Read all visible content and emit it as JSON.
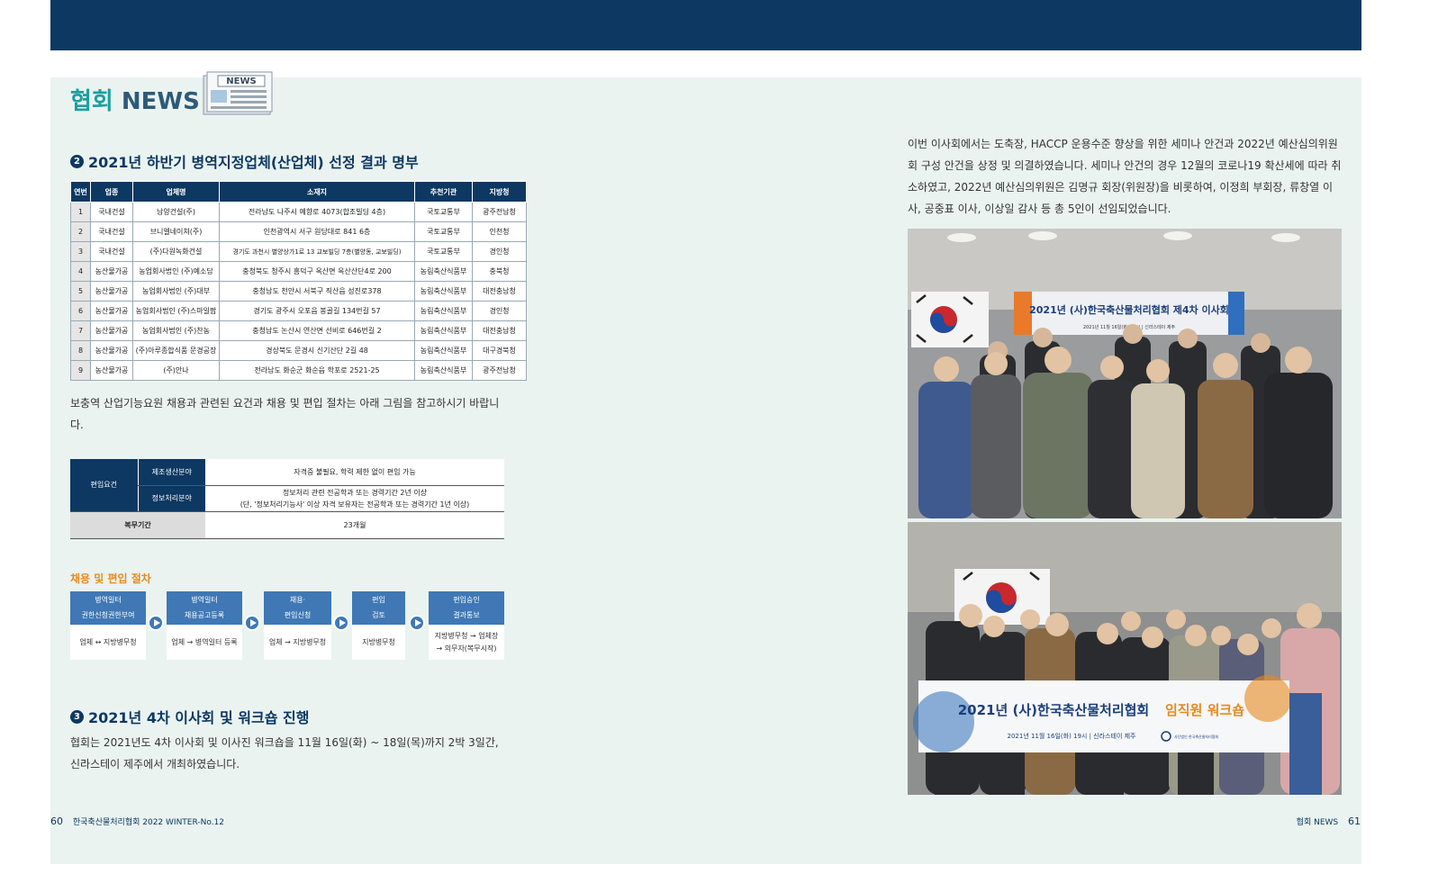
{
  "header": {
    "brand_ko": "협회",
    "brand_en": "NEWS",
    "badge": "NEWS"
  },
  "section2": {
    "num": "2",
    "title": "2021년 하반기 병역지정업체(산업체) 선정 결과 명부",
    "table": {
      "headers": [
        "연번",
        "업종",
        "업체명",
        "소재지",
        "추천기관",
        "지방청"
      ],
      "rows": [
        [
          "1",
          "국내건설",
          "남양건설(주)",
          "전라남도 나주시 예향로 4073(합조빌딩 4층)",
          "국토교통부",
          "광주전남청"
        ],
        [
          "2",
          "국내건설",
          "브니엘네이쳐(주)",
          "인천광역시 서구 원당대로 841 6층",
          "국토교통부",
          "인천청"
        ],
        [
          "3",
          "국내건설",
          "(주)다원녹화건설",
          "경기도 과천시 별양상가1로 13 교보빌딩 7층(별양동, 교보빌딩)",
          "국토교통부",
          "경인청"
        ],
        [
          "4",
          "농산물가공",
          "농업회사법인 (주)예소담",
          "충청북도 청주시 흥덕구 옥산면 옥산산단4로 200",
          "농림축산식품부",
          "충북청"
        ],
        [
          "5",
          "농산물가공",
          "농업회사법인 (주)대부",
          "충청남도 천안시 서북구 직산읍 성진로378",
          "농림축산식품부",
          "대전충남청"
        ],
        [
          "6",
          "농산물가공",
          "농업회사법인 (주)스마일팜",
          "경기도 광주시 오포읍 봉골길 134번길 57",
          "농림축산식품부",
          "경인청"
        ],
        [
          "7",
          "농산물가공",
          "농업회사법인 (주)찬농",
          "충청남도 논산시 연산면 선비로 646번길 2",
          "농림축산식품부",
          "대전충남청"
        ],
        [
          "8",
          "농산물가공",
          "(주)아루종합식품 문경공장",
          "경상북도 문경시 신기산단 2길 48",
          "농림축산식품부",
          "대구경북청"
        ],
        [
          "9",
          "농산물가공",
          "(주)안나",
          "전라남도 화순군 화순읍 학포로 2521-25",
          "농림축산식품부",
          "광주전남청"
        ]
      ]
    },
    "note": "보충역 산업기능요원 채용과 관련된 요건과 채용 및 편입 절차는 아래 그림을 참고하시기 바랍니다.",
    "requirements": {
      "group": "편입요건",
      "manufacturing_label": "제조생산분야",
      "manufacturing_value": "자격증 불필요, 학력 제한 없이 편입 가능",
      "it_label": "정보처리분야",
      "it_value_1": "정보처리 관련 전공학과 또는 경력기간 2년 이상",
      "it_value_2": "(단, '정보처리기능사' 이상 자격 보유자는 전공학과 또는 경력기간 1년 이상)",
      "service_label": "복무기간",
      "service_value": "23개월"
    },
    "process": {
      "title": "채용 및 편입 절차",
      "steps": [
        {
          "head1": "병역일터",
          "head2": "권한신청권한부여",
          "body1": "업체 ↔ 지방병무청",
          "body2": ""
        },
        {
          "head1": "병역일터",
          "head2": "채용공고등록",
          "body1": "업체 → 병역일터 등록",
          "body2": ""
        },
        {
          "head1": "채용·",
          "head2": "편입신청",
          "body1": "업체 → 지방병무청",
          "body2": ""
        },
        {
          "head1": "편입",
          "head2": "검토",
          "body1": "지방병무청",
          "body2": ""
        },
        {
          "head1": "편입승인",
          "head2": "결과통보",
          "body1": "지방병무청 → 업체장",
          "body2": "→ 의무자(복무시작)"
        }
      ]
    }
  },
  "section3": {
    "num": "3",
    "title": "2021년 4차 이사회 및 워크숍 진행",
    "text": "협회는 2021년도 4차 이사회 및 이사진 워크숍을 11월 16일(화) ~ 18일(목)까지 2박 3일간, 신라스테이 제주에서 개최하였습니다."
  },
  "right": {
    "text": "이번 이사회에서는 도축장, HACCP 운용수준 향상을 위한 세미나 안건과 2022년 예산심의위원회 구성 안건을 상정 및 의결하였습니다. 세미나 안건의 경우 12월의 코로나19 확산세에 따라 취소하였고, 2022년 예산심의위원은 김명규 회장(위원장)을 비롯하여, 이정희 부회장, 류창열 이사, 공중표 이사, 이상일 감사 등 총 5인이 선임되었습니다.",
    "photo1_banner": "2021년 (사)한국축산물처리협회 제4차 이사회",
    "photo1_banner_sub": "2021년 11월 16일(화) 15시 | 신라스테이 제주",
    "photo2_banner_a": "2021년 (사)한국축산물처리협회",
    "photo2_banner_b": "임직원 워크숍",
    "photo2_banner_sub": "2021년 11월 16일(화) 19시 | 신라스테이 제주",
    "photo2_logo": "사단법인 한국축산물처리협회"
  },
  "footer": {
    "left_page": "60",
    "left_text": "한국축산물처리협회 2022 WINTER-No.12",
    "right_text": "협회 NEWS",
    "right_page": "61"
  },
  "colors": {
    "navy": "#0c3862",
    "teal": "#1aa0a0",
    "orange": "#e8891e",
    "step_blue": "#3f78b5",
    "page_bg": "#eaf3f0"
  }
}
